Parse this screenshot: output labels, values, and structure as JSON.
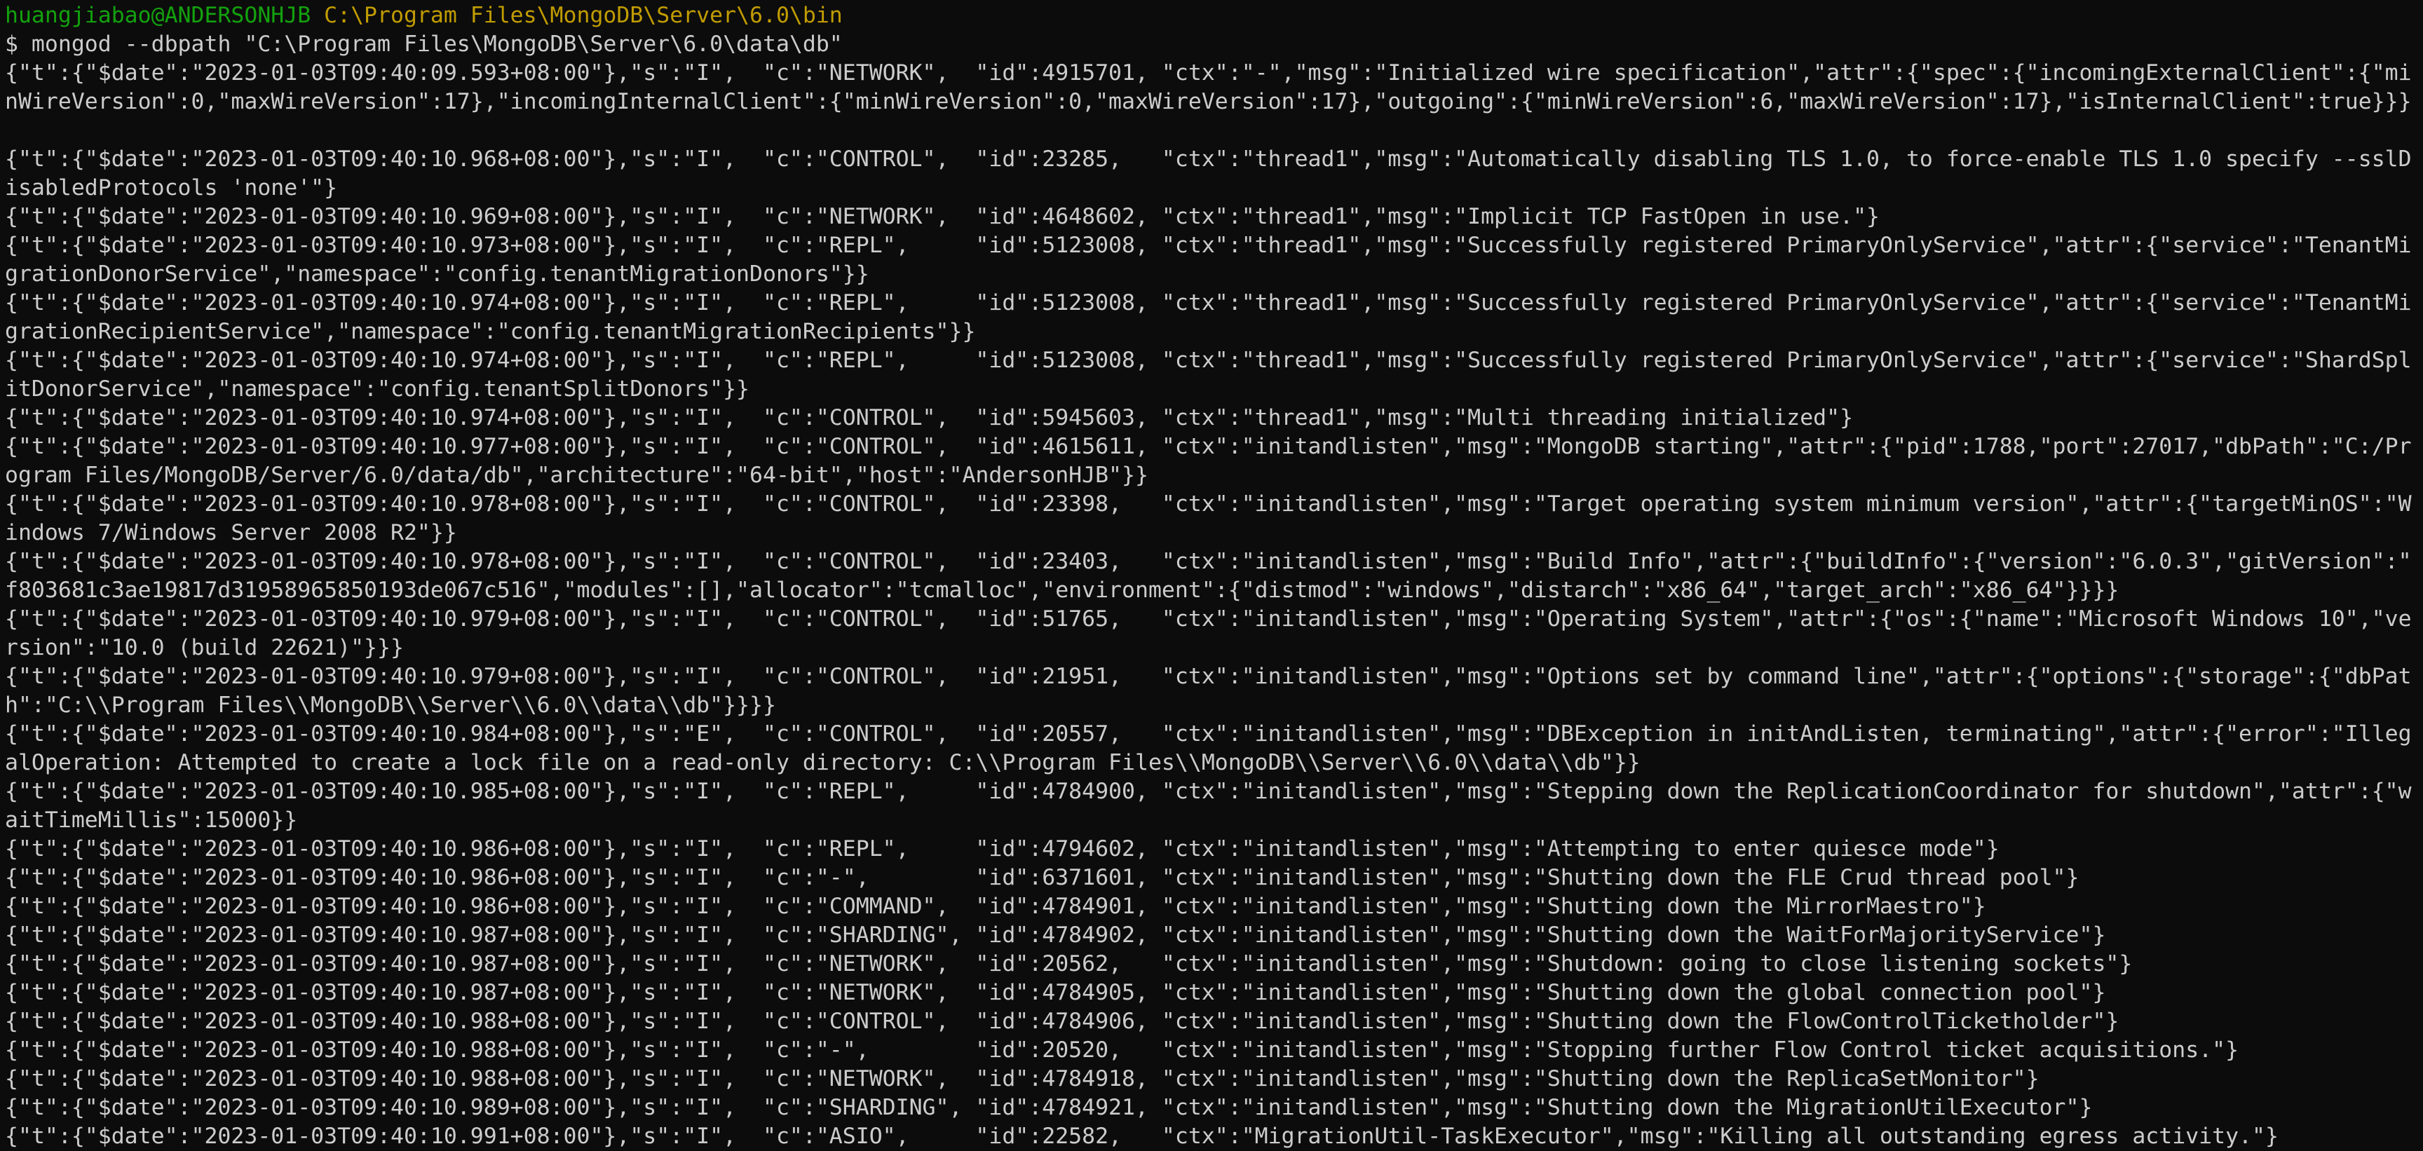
{
  "prompt": {
    "user_host": "huangjiabao@ANDERSONHJB",
    "cwd": "C:\\Program Files\\MongoDB\\Server\\6.0\\bin",
    "symbol": "$",
    "command": " mongod --dbpath \"C:\\Program Files\\MongoDB\\Server\\6.0\\data\\db\""
  },
  "colors": {
    "background": "#0c0c0c",
    "text": "#cccccc",
    "user_host": "#13a10e",
    "cwd": "#c19c00"
  },
  "output_lines": [
    "{\"t\":{\"$date\":\"2023-01-03T09:40:09.593+08:00\"},\"s\":\"I\",  \"c\":\"NETWORK\",  \"id\":4915701, \"ctx\":\"-\",\"msg\":\"Initialized wire specification\",\"attr\":{\"spec\":{\"incomingExternalClient\":{\"mi",
    "nWireVersion\":0,\"maxWireVersion\":17},\"incomingInternalClient\":{\"minWireVersion\":0,\"maxWireVersion\":17},\"outgoing\":{\"minWireVersion\":6,\"maxWireVersion\":17},\"isInternalClient\":true}}}",
    "",
    "{\"t\":{\"$date\":\"2023-01-03T09:40:10.968+08:00\"},\"s\":\"I\",  \"c\":\"CONTROL\",  \"id\":23285,   \"ctx\":\"thread1\",\"msg\":\"Automatically disabling TLS 1.0, to force-enable TLS 1.0 specify --sslD",
    "isabledProtocols 'none'\"}",
    "{\"t\":{\"$date\":\"2023-01-03T09:40:10.969+08:00\"},\"s\":\"I\",  \"c\":\"NETWORK\",  \"id\":4648602, \"ctx\":\"thread1\",\"msg\":\"Implicit TCP FastOpen in use.\"}",
    "{\"t\":{\"$date\":\"2023-01-03T09:40:10.973+08:00\"},\"s\":\"I\",  \"c\":\"REPL\",     \"id\":5123008, \"ctx\":\"thread1\",\"msg\":\"Successfully registered PrimaryOnlyService\",\"attr\":{\"service\":\"TenantMi",
    "grationDonorService\",\"namespace\":\"config.tenantMigrationDonors\"}}",
    "{\"t\":{\"$date\":\"2023-01-03T09:40:10.974+08:00\"},\"s\":\"I\",  \"c\":\"REPL\",     \"id\":5123008, \"ctx\":\"thread1\",\"msg\":\"Successfully registered PrimaryOnlyService\",\"attr\":{\"service\":\"TenantMi",
    "grationRecipientService\",\"namespace\":\"config.tenantMigrationRecipients\"}}",
    "{\"t\":{\"$date\":\"2023-01-03T09:40:10.974+08:00\"},\"s\":\"I\",  \"c\":\"REPL\",     \"id\":5123008, \"ctx\":\"thread1\",\"msg\":\"Successfully registered PrimaryOnlyService\",\"attr\":{\"service\":\"ShardSpl",
    "itDonorService\",\"namespace\":\"config.tenantSplitDonors\"}}",
    "{\"t\":{\"$date\":\"2023-01-03T09:40:10.974+08:00\"},\"s\":\"I\",  \"c\":\"CONTROL\",  \"id\":5945603, \"ctx\":\"thread1\",\"msg\":\"Multi threading initialized\"}",
    "{\"t\":{\"$date\":\"2023-01-03T09:40:10.977+08:00\"},\"s\":\"I\",  \"c\":\"CONTROL\",  \"id\":4615611, \"ctx\":\"initandlisten\",\"msg\":\"MongoDB starting\",\"attr\":{\"pid\":1788,\"port\":27017,\"dbPath\":\"C:/Pr",
    "ogram Files/MongoDB/Server/6.0/data/db\",\"architecture\":\"64-bit\",\"host\":\"AndersonHJB\"}}",
    "{\"t\":{\"$date\":\"2023-01-03T09:40:10.978+08:00\"},\"s\":\"I\",  \"c\":\"CONTROL\",  \"id\":23398,   \"ctx\":\"initandlisten\",\"msg\":\"Target operating system minimum version\",\"attr\":{\"targetMinOS\":\"W",
    "indows 7/Windows Server 2008 R2\"}}",
    "{\"t\":{\"$date\":\"2023-01-03T09:40:10.978+08:00\"},\"s\":\"I\",  \"c\":\"CONTROL\",  \"id\":23403,   \"ctx\":\"initandlisten\",\"msg\":\"Build Info\",\"attr\":{\"buildInfo\":{\"version\":\"6.0.3\",\"gitVersion\":\"",
    "f803681c3ae19817d31958965850193de067c516\",\"modules\":[],\"allocator\":\"tcmalloc\",\"environment\":{\"distmod\":\"windows\",\"distarch\":\"x86_64\",\"target_arch\":\"x86_64\"}}}}",
    "{\"t\":{\"$date\":\"2023-01-03T09:40:10.979+08:00\"},\"s\":\"I\",  \"c\":\"CONTROL\",  \"id\":51765,   \"ctx\":\"initandlisten\",\"msg\":\"Operating System\",\"attr\":{\"os\":{\"name\":\"Microsoft Windows 10\",\"ve",
    "rsion\":\"10.0 (build 22621)\"}}}",
    "{\"t\":{\"$date\":\"2023-01-03T09:40:10.979+08:00\"},\"s\":\"I\",  \"c\":\"CONTROL\",  \"id\":21951,   \"ctx\":\"initandlisten\",\"msg\":\"Options set by command line\",\"attr\":{\"options\":{\"storage\":{\"dbPat",
    "h\":\"C:\\\\Program Files\\\\MongoDB\\\\Server\\\\6.0\\\\data\\\\db\"}}}}",
    "{\"t\":{\"$date\":\"2023-01-03T09:40:10.984+08:00\"},\"s\":\"E\",  \"c\":\"CONTROL\",  \"id\":20557,   \"ctx\":\"initandlisten\",\"msg\":\"DBException in initAndListen, terminating\",\"attr\":{\"error\":\"Illeg",
    "alOperation: Attempted to create a lock file on a read-only directory: C:\\\\Program Files\\\\MongoDB\\\\Server\\\\6.0\\\\data\\\\db\"}}",
    "{\"t\":{\"$date\":\"2023-01-03T09:40:10.985+08:00\"},\"s\":\"I\",  \"c\":\"REPL\",     \"id\":4784900, \"ctx\":\"initandlisten\",\"msg\":\"Stepping down the ReplicationCoordinator for shutdown\",\"attr\":{\"w",
    "aitTimeMillis\":15000}}",
    "{\"t\":{\"$date\":\"2023-01-03T09:40:10.986+08:00\"},\"s\":\"I\",  \"c\":\"REPL\",     \"id\":4794602, \"ctx\":\"initandlisten\",\"msg\":\"Attempting to enter quiesce mode\"}",
    "{\"t\":{\"$date\":\"2023-01-03T09:40:10.986+08:00\"},\"s\":\"I\",  \"c\":\"-\",        \"id\":6371601, \"ctx\":\"initandlisten\",\"msg\":\"Shutting down the FLE Crud thread pool\"}",
    "{\"t\":{\"$date\":\"2023-01-03T09:40:10.986+08:00\"},\"s\":\"I\",  \"c\":\"COMMAND\",  \"id\":4784901, \"ctx\":\"initandlisten\",\"msg\":\"Shutting down the MirrorMaestro\"}",
    "{\"t\":{\"$date\":\"2023-01-03T09:40:10.987+08:00\"},\"s\":\"I\",  \"c\":\"SHARDING\", \"id\":4784902, \"ctx\":\"initandlisten\",\"msg\":\"Shutting down the WaitForMajorityService\"}",
    "{\"t\":{\"$date\":\"2023-01-03T09:40:10.987+08:00\"},\"s\":\"I\",  \"c\":\"NETWORK\",  \"id\":20562,   \"ctx\":\"initandlisten\",\"msg\":\"Shutdown: going to close listening sockets\"}",
    "{\"t\":{\"$date\":\"2023-01-03T09:40:10.987+08:00\"},\"s\":\"I\",  \"c\":\"NETWORK\",  \"id\":4784905, \"ctx\":\"initandlisten\",\"msg\":\"Shutting down the global connection pool\"}",
    "{\"t\":{\"$date\":\"2023-01-03T09:40:10.988+08:00\"},\"s\":\"I\",  \"c\":\"CONTROL\",  \"id\":4784906, \"ctx\":\"initandlisten\",\"msg\":\"Shutting down the FlowControlTicketholder\"}",
    "{\"t\":{\"$date\":\"2023-01-03T09:40:10.988+08:00\"},\"s\":\"I\",  \"c\":\"-\",        \"id\":20520,   \"ctx\":\"initandlisten\",\"msg\":\"Stopping further Flow Control ticket acquisitions.\"}",
    "{\"t\":{\"$date\":\"2023-01-03T09:40:10.988+08:00\"},\"s\":\"I\",  \"c\":\"NETWORK\",  \"id\":4784918, \"ctx\":\"initandlisten\",\"msg\":\"Shutting down the ReplicaSetMonitor\"}",
    "{\"t\":{\"$date\":\"2023-01-03T09:40:10.989+08:00\"},\"s\":\"I\",  \"c\":\"SHARDING\", \"id\":4784921, \"ctx\":\"initandlisten\",\"msg\":\"Shutting down the MigrationUtilExecutor\"}",
    "{\"t\":{\"$date\":\"2023-01-03T09:40:10.991+08:00\"},\"s\":\"I\",  \"c\":\"ASIO\",     \"id\":22582,   \"ctx\":\"MigrationUtil-TaskExecutor\",\"msg\":\"Killing all outstanding egress activity.\"}"
  ]
}
